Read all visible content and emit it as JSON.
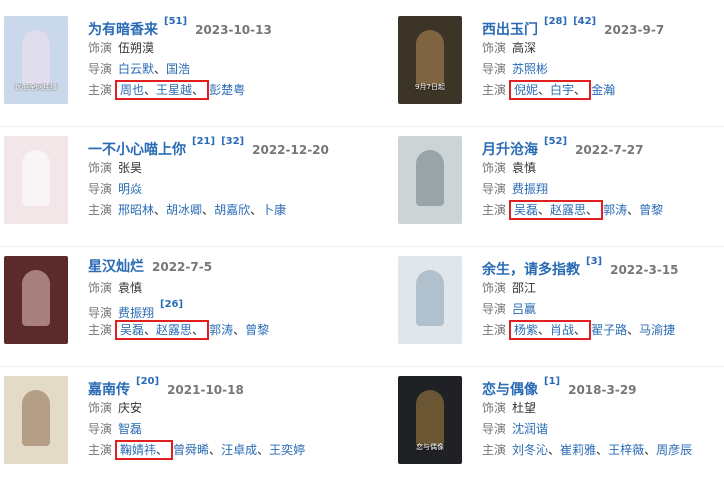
{
  "labels": {
    "voice": "饰演",
    "director": "导演",
    "cast": "主演"
  },
  "sep": "、",
  "cards": [
    {
      "title": "为有暗香来",
      "sups": [
        "[51]"
      ],
      "date": "2023-10-13",
      "voice": "伍朔漠",
      "director": [
        "白云默",
        "国浩"
      ],
      "cast_hl": [
        "周也",
        "王星越"
      ],
      "cast_rest": [
        "彭楚粤"
      ],
      "poster": {
        "bg": "#c9d8ea",
        "fig": "#f3e3ee",
        "text": "优酷全网独播"
      }
    },
    {
      "title": "西出玉门",
      "sups": [
        "[28]",
        "[42]"
      ],
      "date": "2023-9-7",
      "voice": "高深",
      "director": [
        "苏照彬"
      ],
      "cast_hl": [
        "倪妮",
        "白宇"
      ],
      "cast_rest": [
        "金瀚"
      ],
      "poster": {
        "bg": "#3d3428",
        "fig": "#b58c55",
        "text": "9月7日起"
      }
    },
    {
      "title": "一不小心喵上你",
      "sups": [
        "[21]",
        "[32]"
      ],
      "date": "2022-12-20",
      "voice": "张昊",
      "director": [
        "明焱"
      ],
      "cast_hl": [],
      "cast_rest": [
        "邢昭林",
        "胡冰卿",
        "胡嘉欣",
        "卜康"
      ],
      "poster": {
        "bg": "#f2e6e8",
        "fig": "#ffffff",
        "text": ""
      }
    },
    {
      "title": "月升沧海",
      "sups": [
        "[52]"
      ],
      "date": "2022-7-27",
      "voice": "袁慎",
      "director": [
        "费振翔"
      ],
      "cast_hl": [
        "吴磊",
        "赵露思"
      ],
      "cast_rest": [
        "郭涛",
        "曾黎"
      ],
      "poster": {
        "bg": "#cdd4d6",
        "fig": "#6e7b84",
        "text": ""
      }
    },
    {
      "title": "星汉灿烂",
      "sups": [],
      "date": "2022-7-5",
      "voice": "袁慎",
      "director": [
        "费振翔"
      ],
      "director_sup": "[26]",
      "cast_hl": [
        "吴磊",
        "赵露思"
      ],
      "cast_rest": [
        "郭涛",
        "曾黎"
      ],
      "poster": {
        "bg": "#5b2a2a",
        "fig": "#e8c9c2",
        "text": ""
      }
    },
    {
      "title": "余生，请多指教",
      "sups": [
        "[3]"
      ],
      "date": "2022-3-15",
      "voice": "邵江",
      "director": [
        "吕赢"
      ],
      "cast_hl": [
        "杨紫",
        "肖战"
      ],
      "cast_rest": [
        "翟子路",
        "马渝捷"
      ],
      "poster": {
        "bg": "#dfe6ec",
        "fig": "#8aa0b4",
        "text": ""
      }
    },
    {
      "title": "嘉南传",
      "sups": [
        "[20]"
      ],
      "date": "2021-10-18",
      "voice": "庆安",
      "director": [
        "智磊"
      ],
      "cast_hl": [
        "鞠婧祎"
      ],
      "cast_rest": [
        "曾舜晞",
        "汪卓成",
        "王奕婷"
      ],
      "poster": {
        "bg": "#e4dac8",
        "fig": "#8d6e4e",
        "text": ""
      }
    },
    {
      "title": "恋与偶像",
      "sups": [
        "[1]"
      ],
      "date": "2018-3-29",
      "voice": "杜望",
      "director": [
        "沈润谐"
      ],
      "cast_hl": [],
      "cast_rest": [
        "刘冬沁",
        "崔莉雅",
        "王梓薇",
        "周彦辰"
      ],
      "poster": {
        "bg": "#1f2124",
        "fig": "#a8843f",
        "text": "恋与偶像"
      }
    }
  ]
}
